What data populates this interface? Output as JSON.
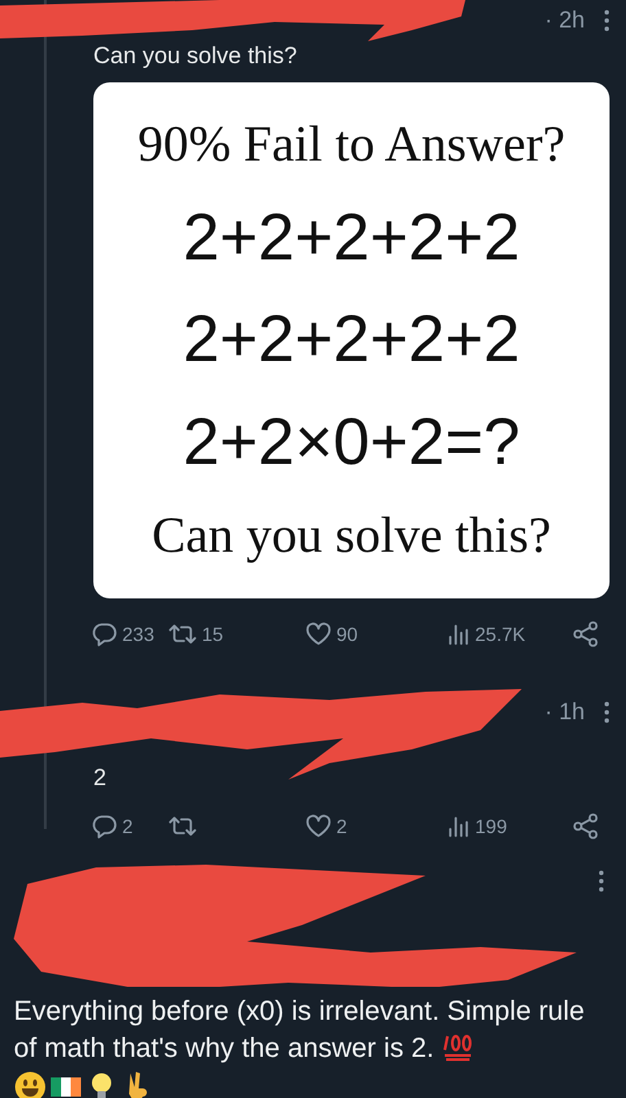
{
  "posts": [
    {
      "kind": "reply",
      "time": "· 2h",
      "text": "Can you solve this?",
      "image": {
        "lines": [
          {
            "kind": "title",
            "text": "90% Fail to Answer?"
          },
          {
            "kind": "math",
            "text": "2+2+2+2+2"
          },
          {
            "kind": "math",
            "text": "2+2+2+2+2"
          },
          {
            "kind": "math",
            "text": "2+2×0+2=?"
          },
          {
            "kind": "title",
            "text": "Can you solve this?"
          }
        ]
      },
      "actions": {
        "replies": "233",
        "reposts": "15",
        "likes": "90",
        "views": "25.7K"
      }
    },
    {
      "kind": "reply",
      "time": "· 1h",
      "text": "2",
      "actions": {
        "replies": "2",
        "likes": "2",
        "views": "199"
      }
    },
    {
      "kind": "focused",
      "text": "Everything before (x0) is irrelevant. Simple rule of math that's why the answer is 2."
    }
  ]
}
